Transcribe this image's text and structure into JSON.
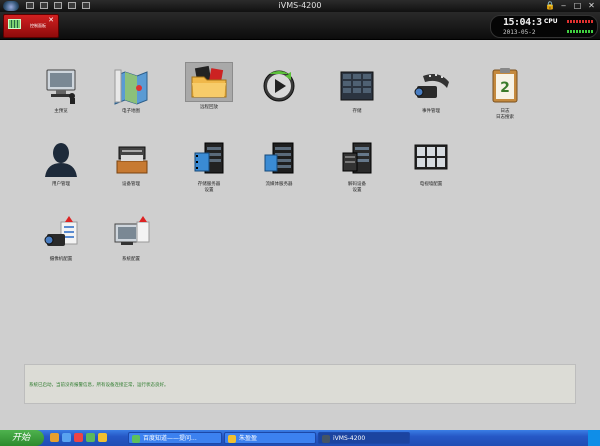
{
  "window": {
    "title": "iVMS-4200"
  },
  "toolbar": {
    "main_tab_label": "控制面板",
    "clock_time": "15:04:3",
    "clock_date": "2013-05-2",
    "cpu_label": "CPU"
  },
  "modules": [
    {
      "id": "monitor",
      "label": "主预览"
    },
    {
      "id": "emap",
      "label": "电子地图"
    },
    {
      "id": "playback",
      "label": "远程回放"
    },
    {
      "id": "remote-playback",
      "label": ""
    },
    {
      "id": "storage",
      "label": "存储"
    },
    {
      "id": "camera-tour",
      "label": "事件管理"
    },
    {
      "id": "log",
      "label": "日志",
      "label2": "日志搜索"
    },
    {
      "id": "user",
      "label": "用户管理"
    },
    {
      "id": "device",
      "label": "设备管理"
    },
    {
      "id": "storage-server",
      "label": "存储服务器",
      "label2": "设置"
    },
    {
      "id": "stream-server",
      "label": "流媒体服务器"
    },
    {
      "id": "decoder",
      "label": "解码设备",
      "label2": "设置"
    },
    {
      "id": "video-wall",
      "label": "电视墙配置"
    },
    {
      "id": "camera-config",
      "label": "摄像机配置"
    },
    {
      "id": "system-config",
      "label": "系统配置"
    }
  ],
  "log": {
    "text": "系统已启动，当前没有报警信息，所有设备连接正常，运行状态良好。"
  },
  "taskbar": {
    "start": "开始",
    "tasks": [
      {
        "label": "百度知道——提问..."
      },
      {
        "label": "朱盈盈"
      },
      {
        "label": "iVMS-4200"
      }
    ]
  },
  "colors": {
    "accent": "#c41414",
    "background": "#cfcfcf",
    "taskbar": "#2658c6"
  }
}
